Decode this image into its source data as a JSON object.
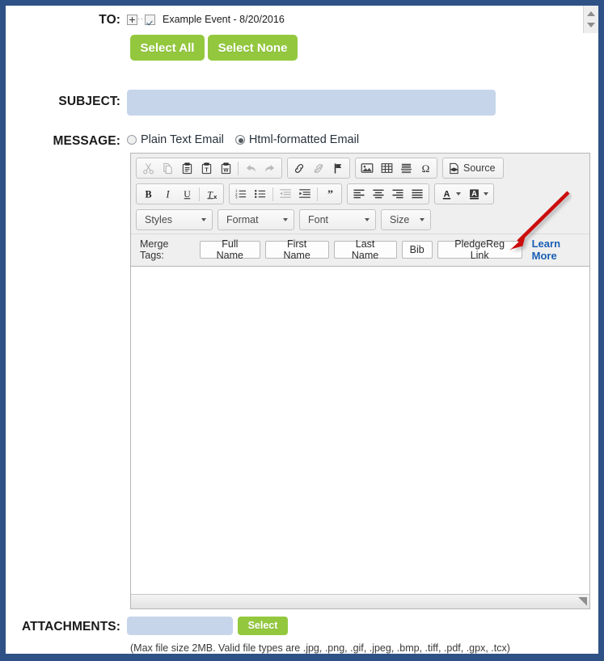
{
  "form": {
    "to": {
      "label": "TO:",
      "tree_item": "Example Event - 8/20/2016",
      "expander_icon": "plus-expander-icon",
      "checkbox_icon": "checked-checkbox-icon",
      "select_all_label": "Select All",
      "select_none_label": "Select None"
    },
    "subject": {
      "label": "SUBJECT:",
      "value": "",
      "placeholder": ""
    },
    "message": {
      "label": "MESSAGE:",
      "options": [
        {
          "label": "Plain Text Email",
          "selected": false
        },
        {
          "label": "Html-formatted Email",
          "selected": true
        }
      ]
    },
    "attachments": {
      "label": "ATTACHMENTS:",
      "value": "",
      "placeholder": "",
      "select_label": "Select",
      "help_text": "(Max file size 2MB. Valid file types are .jpg, .png, .gif, .jpeg, .bmp, .tiff, .pdf, .gpx, .tcx)"
    }
  },
  "editor": {
    "toolbar_row1": [
      {
        "name": "cut-icon",
        "title": "Cut",
        "disabled": true
      },
      {
        "name": "copy-icon",
        "title": "Copy",
        "disabled": true
      },
      {
        "name": "paste-icon",
        "title": "Paste",
        "disabled": false
      },
      {
        "name": "paste-as-plain-text-icon",
        "title": "Paste as plain text",
        "disabled": false
      },
      {
        "name": "paste-from-word-icon",
        "title": "Paste from Word",
        "disabled": false
      },
      {
        "name": "undo-icon",
        "title": "Undo",
        "disabled": true
      },
      {
        "name": "redo-icon",
        "title": "Redo",
        "disabled": true
      },
      {
        "name": "link-icon",
        "title": "Link",
        "disabled": false
      },
      {
        "name": "unlink-icon",
        "title": "Unlink",
        "disabled": true
      },
      {
        "name": "anchor-flag-icon",
        "title": "Anchor",
        "disabled": false
      },
      {
        "name": "image-icon",
        "title": "Image",
        "disabled": false
      },
      {
        "name": "table-icon",
        "title": "Table",
        "disabled": false
      },
      {
        "name": "horizontal-rule-icon",
        "title": "Horizontal Line",
        "disabled": false
      },
      {
        "name": "special-character-omega-icon",
        "title": "Insert Special Character",
        "disabled": false
      }
    ],
    "source_button": {
      "label": "Source",
      "icon": "source-page-icon"
    },
    "toolbar_row2": [
      {
        "name": "bold-icon",
        "title": "Bold"
      },
      {
        "name": "italic-icon",
        "title": "Italic"
      },
      {
        "name": "underline-icon",
        "title": "Underline"
      },
      {
        "name": "remove-format-icon",
        "title": "Remove Format"
      },
      {
        "name": "numbered-list-icon",
        "title": "Insert/Remove Numbered List"
      },
      {
        "name": "bulleted-list-icon",
        "title": "Insert/Remove Bulleted List"
      },
      {
        "name": "outdent-icon",
        "title": "Decrease Indent",
        "disabled": true
      },
      {
        "name": "indent-icon",
        "title": "Increase Indent"
      },
      {
        "name": "blockquote-icon",
        "title": "Block Quote"
      },
      {
        "name": "align-left-icon",
        "title": "Align Left"
      },
      {
        "name": "align-center-icon",
        "title": "Center"
      },
      {
        "name": "align-right-icon",
        "title": "Align Right"
      },
      {
        "name": "justify-icon",
        "title": "Justify"
      },
      {
        "name": "text-color-icon",
        "title": "Text Color"
      },
      {
        "name": "background-color-icon",
        "title": "Background Color"
      }
    ],
    "combos": [
      {
        "name": "styles",
        "label": "Styles"
      },
      {
        "name": "format",
        "label": "Format"
      },
      {
        "name": "font",
        "label": "Font"
      },
      {
        "name": "size",
        "label": "Size"
      }
    ],
    "merge_tags": {
      "label": "Merge Tags:",
      "buttons": [
        "Full Name",
        "First Name",
        "Last Name",
        "Bib",
        "PledgeReg Link"
      ],
      "learn_more": "Learn More"
    },
    "body_text": "",
    "resize_grip_icon": "resize-grip-icon"
  },
  "annotation": {
    "arrow_color": "#cc1111",
    "points_to": "PledgeReg Link"
  },
  "scroll_spinner": {
    "up_icon": "spinner-up-icon",
    "down_icon": "spinner-down-icon"
  },
  "colors": {
    "frame": "#2e5286",
    "green_button": "#93c83e",
    "input_fill": "#c6d5ea",
    "link": "#1a5fb4"
  }
}
